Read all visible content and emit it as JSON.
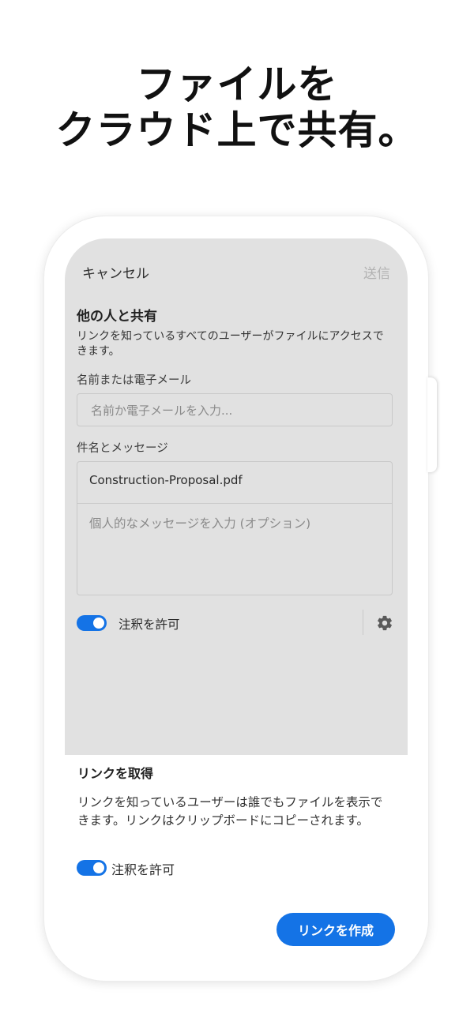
{
  "headline": {
    "line1": "ファイルを",
    "line2": "クラウド上で共有。"
  },
  "share_sheet": {
    "cancel_label": "キャンセル",
    "send_label": "送信",
    "heading": "他の人と共有",
    "description": "リンクを知っているすべてのユーザーがファイルにアクセスできます。",
    "recipient_label": "名前または電子メール",
    "recipient_placeholder": "名前か電子メールを入力...",
    "message_label": "件名とメッセージ",
    "subject_value": "Construction-Proposal.pdf",
    "message_placeholder": "個人的なメッセージを入力 (オプション)",
    "allow_comments_label": "注釈を許可",
    "allow_comments_on": true,
    "settings_icon": "gear-icon"
  },
  "get_link": {
    "heading": "リンクを取得",
    "description": "リンクを知っているユーザーは誰でもファイルを表示できます。リンクはクリップボードにコピーされます。",
    "allow_comments_label": "注釈を許可",
    "allow_comments_on": true,
    "create_button_label": "リンクを作成"
  },
  "colors": {
    "accent": "#1473e6",
    "sheet_background": "#e1e1e1",
    "disabled_text": "#b2b2b2"
  }
}
